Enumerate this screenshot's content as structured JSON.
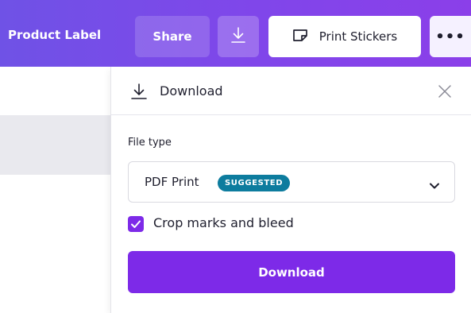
{
  "topbar": {
    "doc_title": "Product Label",
    "share_label": "Share",
    "download_icon": "download-icon",
    "print_label": "Print Stickers",
    "print_icon": "sticker-icon",
    "more_label": "•••"
  },
  "panel": {
    "title": "Download",
    "header_icon": "download-icon",
    "close_icon": "close-icon",
    "file_type_label": "File type",
    "file_type_value": "PDF Print",
    "file_type_badge": "SUGGESTED",
    "crop_marks_label": "Crop marks and bleed",
    "crop_marks_checked": true,
    "download_button_label": "Download"
  },
  "colors": {
    "topbar_gradient_start": "#6f52e6",
    "topbar_gradient_end": "#8b3fe9",
    "primary": "#7d2ae8",
    "badge": "#0d7c9e"
  }
}
